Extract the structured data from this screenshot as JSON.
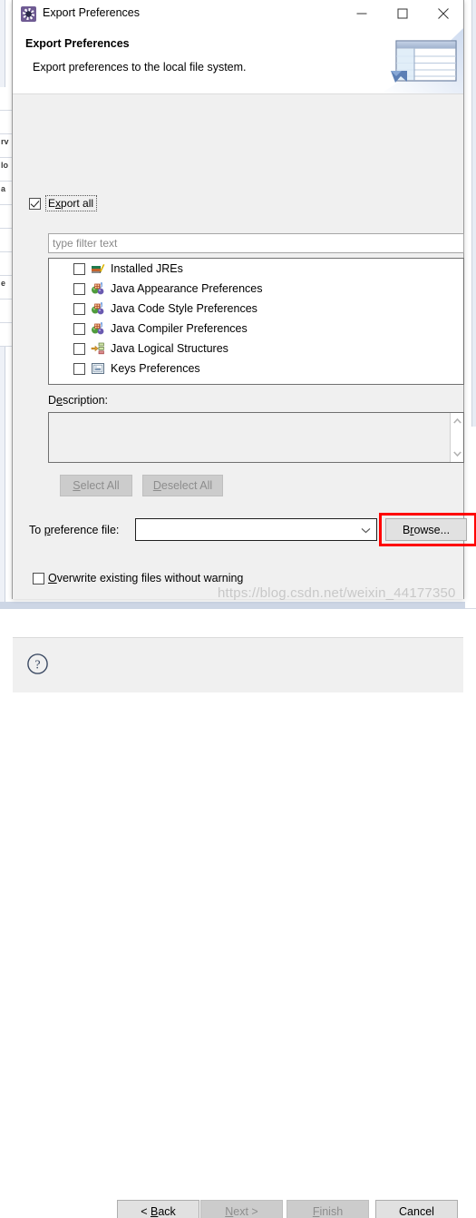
{
  "window": {
    "title": "Export Preferences",
    "icon": "eclipse-gear-icon",
    "minimize_label": "–",
    "maximize_label": "□",
    "close_label": "✕"
  },
  "header": {
    "title": "Export Preferences",
    "subtitle": "Export preferences to the local file system.",
    "art": "export-table-arrow-icon"
  },
  "export_all": {
    "label": "Export all",
    "mnemonic": "a",
    "checked": true,
    "focused": true
  },
  "filter": {
    "placeholder": "type filter text",
    "value": ""
  },
  "tree": {
    "items": [
      {
        "label": "Installed JREs",
        "icon": "installed-jres-icon",
        "checked": false
      },
      {
        "label": "Java Appearance Preferences",
        "icon": "java-preferences-icon",
        "checked": false
      },
      {
        "label": "Java Code Style Preferences",
        "icon": "java-preferences-icon",
        "checked": false
      },
      {
        "label": "Java Compiler Preferences",
        "icon": "java-preferences-icon",
        "checked": false
      },
      {
        "label": "Java Logical Structures",
        "icon": "logical-structures-icon",
        "checked": false
      },
      {
        "label": "Keys Preferences",
        "icon": "keys-preferences-icon",
        "checked": false
      }
    ]
  },
  "description": {
    "label": "Description:",
    "value": ""
  },
  "selection_buttons": {
    "select_all": "Select All",
    "select_all_enabled": false,
    "deselect_all": "Deselect All",
    "deselect_all_enabled": false
  },
  "preference_file": {
    "label": "To preference file:",
    "value": "",
    "browse_label": "Browse...",
    "browse_highlighted": true
  },
  "overwrite": {
    "label": "Overwrite existing files without warning",
    "checked": false
  },
  "footer": {
    "help_label": "?",
    "back": "< Back",
    "back_enabled": true,
    "next": "Next >",
    "next_enabled": false,
    "finish": "Finish",
    "finish_enabled": false,
    "cancel": "Cancel",
    "cancel_enabled": true
  },
  "watermark": "https://blog.csdn.net/weixin_44177350",
  "colors": {
    "dialog_bg": "#f0f0f0",
    "title_icon": "#6f5b93",
    "highlight_red": "#ff0000",
    "header_bg": "#ffffff"
  }
}
